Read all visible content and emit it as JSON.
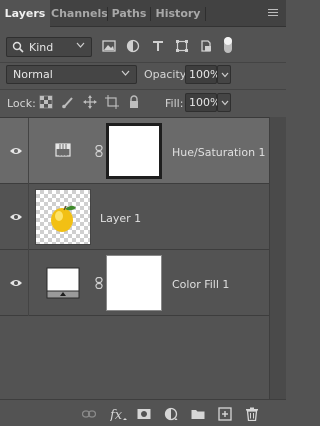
{
  "tabs": [
    {
      "label": "Layers",
      "active": true
    },
    {
      "label": "Channels",
      "active": false
    },
    {
      "label": "Paths",
      "active": false
    },
    {
      "label": "History",
      "active": false
    }
  ],
  "filter": {
    "kind_label": "Kind",
    "icons": [
      "image-filter-icon",
      "adjustment-filter-icon",
      "type-filter-icon",
      "shape-filter-icon",
      "smart-object-filter-icon"
    ],
    "toggle_on": true
  },
  "blend": {
    "mode": "Normal",
    "opacity_label": "Opacity:",
    "opacity_value": "100%"
  },
  "lock": {
    "label": "Lock:",
    "fill_label": "Fill:",
    "fill_value": "100%"
  },
  "layers": [
    {
      "name": "Hue/Saturation 1",
      "type": "adjustment",
      "selected": true,
      "visible": true
    },
    {
      "name": "Layer 1",
      "type": "pixel",
      "selected": false,
      "visible": true
    },
    {
      "name": "Color Fill 1",
      "type": "fill",
      "selected": false,
      "visible": true
    }
  ],
  "colors": {
    "panel_bg": "#535353",
    "tabbar_bg": "#424242",
    "selected_row": "#6a6a6a",
    "text": "#d6d6d6"
  }
}
